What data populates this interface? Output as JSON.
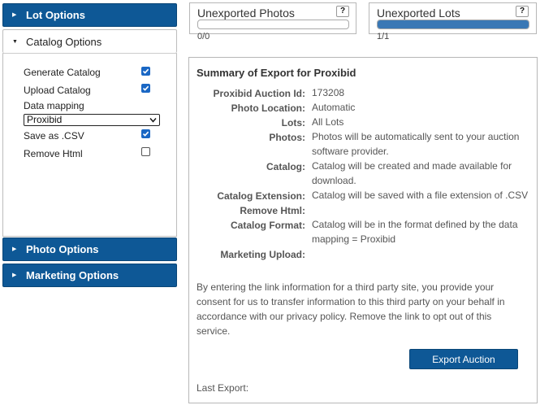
{
  "sidebar": {
    "lot_options": "Lot Options",
    "catalog_options": "Catalog Options",
    "photo_options": "Photo Options",
    "marketing_options": "Marketing Options",
    "catalog": {
      "generate_catalog": {
        "label": "Generate Catalog",
        "checked": true
      },
      "upload_catalog": {
        "label": "Upload Catalog",
        "checked": true
      },
      "data_mapping_label": "Data mapping",
      "data_mapping_value": "Proxibid",
      "save_as_csv": {
        "label": "Save as .CSV",
        "checked": true
      },
      "remove_html": {
        "label": "Remove Html",
        "checked": false
      }
    }
  },
  "stats": {
    "unexported_photos": {
      "title": "Unexported Photos",
      "help": "?",
      "count": "0/0",
      "progress": 0
    },
    "unexported_lots": {
      "title": "Unexported Lots",
      "help": "?",
      "count": "1/1",
      "progress": 1
    }
  },
  "summary": {
    "title": "Summary of Export for Proxibid",
    "rows": [
      {
        "label": "Proxibid Auction Id:",
        "value": "173208"
      },
      {
        "label": "Photo Location:",
        "value": "Automatic"
      },
      {
        "label": "Lots:",
        "value": "All Lots"
      },
      {
        "label": "Photos:",
        "value": "Photos will be automatically sent to your auction software provider."
      },
      {
        "label": "Catalog:",
        "value": "Catalog will be created and made available for download."
      },
      {
        "label": "Catalog Extension:",
        "value": "Catalog will be saved with a file extension of .CSV"
      },
      {
        "label": "Remove Html:",
        "value": ""
      },
      {
        "label": "Catalog Format:",
        "value": "Catalog will be in the format defined by the data mapping = Proxibid"
      },
      {
        "label": "Marketing Upload:",
        "value": ""
      }
    ],
    "consent": "By entering the link information for a third party site, you provide your consent for us to transfer information to this third party on your behalf in accordance with our privacy policy. Remove the link to opt out of this service.",
    "export_button": "Export Auction",
    "last_export": "Last Export:"
  },
  "colors": {
    "accent": "#0e5896",
    "checkbox": "#1a67c4",
    "progress": "#3a78b5"
  },
  "icons": {
    "collapsed": "caret-right-icon",
    "expanded": "caret-down-icon",
    "select": "chevron-down-icon",
    "check": "check-icon"
  }
}
